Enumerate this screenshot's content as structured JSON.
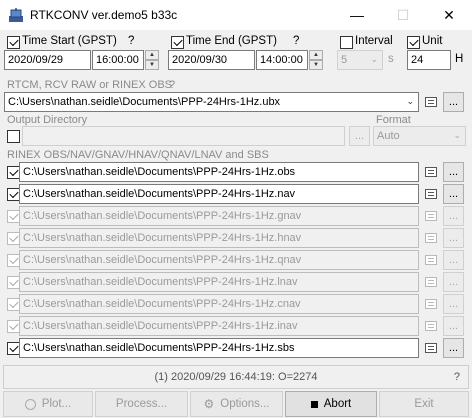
{
  "window": {
    "title": "RTKCONV ver.demo5 b33c",
    "minimize_glyph": "—",
    "maximize_glyph": "☐",
    "close_glyph": "✕"
  },
  "time": {
    "start_label": "Time Start (GPST)",
    "start_help": "?",
    "start_checked": true,
    "start_date": "2020/09/29",
    "start_time": "16:00:00",
    "end_label": "Time End (GPST)",
    "end_help": "?",
    "end_checked": true,
    "end_date": "2020/09/30",
    "end_time": "14:00:00",
    "interval_label": "Interval",
    "interval_checked": false,
    "interval_value": "5",
    "interval_unit": "s",
    "unit_label": "Unit",
    "unit_checked": true,
    "unit_value": "24",
    "unit_suffix": "H"
  },
  "input_section": {
    "label": "RTCM, RCV RAW or RINEX OBS",
    "help": "?",
    "file": "C:\\Users\\nathan.seidle\\Documents\\PPP-24Hrs-1Hz.ubx"
  },
  "output_dir": {
    "label": "Output Directory",
    "checked": false,
    "value": "",
    "format_label": "Format",
    "format_value": "Auto"
  },
  "outputs_section": {
    "label": "RINEX OBS/NAV/GNAV/HNAV/QNAV/LNAV and SBS",
    "rows": [
      {
        "checked": true,
        "enabled": true,
        "file": "C:\\Users\\nathan.seidle\\Documents\\PPP-24Hrs-1Hz.obs"
      },
      {
        "checked": true,
        "enabled": true,
        "file": "C:\\Users\\nathan.seidle\\Documents\\PPP-24Hrs-1Hz.nav"
      },
      {
        "checked": true,
        "enabled": false,
        "file": "C:\\Users\\nathan.seidle\\Documents\\PPP-24Hrs-1Hz.gnav"
      },
      {
        "checked": true,
        "enabled": false,
        "file": "C:\\Users\\nathan.seidle\\Documents\\PPP-24Hrs-1Hz.hnav"
      },
      {
        "checked": true,
        "enabled": false,
        "file": "C:\\Users\\nathan.seidle\\Documents\\PPP-24Hrs-1Hz.qnav"
      },
      {
        "checked": true,
        "enabled": false,
        "file": "C:\\Users\\nathan.seidle\\Documents\\PPP-24Hrs-1Hz.lnav"
      },
      {
        "checked": true,
        "enabled": false,
        "file": "C:\\Users\\nathan.seidle\\Documents\\PPP-24Hrs-1Hz.cnav"
      },
      {
        "checked": true,
        "enabled": false,
        "file": "C:\\Users\\nathan.seidle\\Documents\\PPP-24Hrs-1Hz.inav"
      },
      {
        "checked": true,
        "enabled": true,
        "file": "C:\\Users\\nathan.seidle\\Documents\\PPP-24Hrs-1Hz.sbs"
      }
    ]
  },
  "status": {
    "message": "(1) 2020/09/29 16:44:19: O=2274",
    "help": "?"
  },
  "buttons": {
    "plot": "Plot...",
    "process": "Process...",
    "options": "Options...",
    "abort": "Abort",
    "exit": "Exit",
    "dots": "..."
  }
}
